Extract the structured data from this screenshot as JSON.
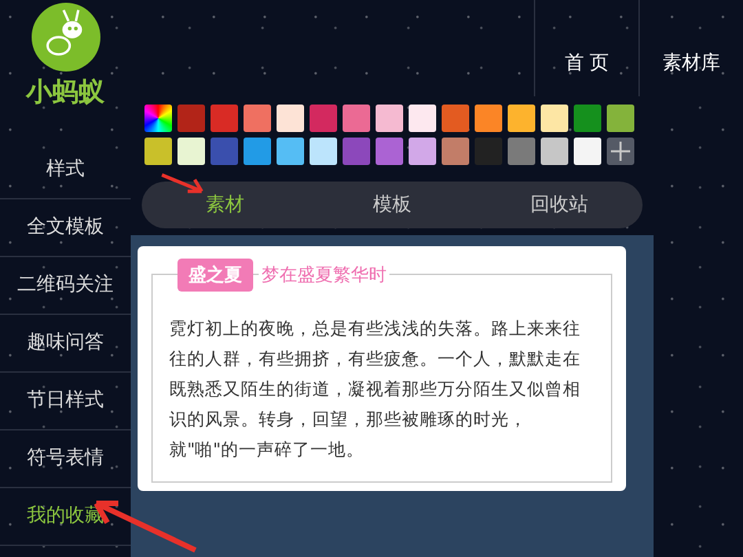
{
  "logo": {
    "text": "小蚂蚁"
  },
  "top_nav": [
    {
      "label": "首 页"
    },
    {
      "label": "素材库"
    }
  ],
  "sidebar": {
    "items": [
      {
        "label": "样式",
        "selected": false
      },
      {
        "label": "全文模板",
        "selected": false
      },
      {
        "label": "二维码关注",
        "selected": false
      },
      {
        "label": "趣味问答",
        "selected": false
      },
      {
        "label": "节日样式",
        "selected": false
      },
      {
        "label": "符号表情",
        "selected": false
      },
      {
        "label": "我的收藏",
        "selected": true
      }
    ]
  },
  "palette": [
    {
      "kind": "rainbow"
    },
    {
      "kind": "color",
      "color": "#b22418"
    },
    {
      "kind": "color",
      "color": "#d92b25"
    },
    {
      "kind": "color",
      "color": "#ef7061"
    },
    {
      "kind": "color",
      "color": "#fde3d6"
    },
    {
      "kind": "color",
      "color": "#d3295f"
    },
    {
      "kind": "color",
      "color": "#eb6a94"
    },
    {
      "kind": "color",
      "color": "#f5bad1"
    },
    {
      "kind": "color",
      "color": "#fde8ef"
    },
    {
      "kind": "color",
      "color": "#e35b21"
    },
    {
      "kind": "color",
      "color": "#fb8526"
    },
    {
      "kind": "color",
      "color": "#fdb32d"
    },
    {
      "kind": "color",
      "color": "#fde6a4"
    },
    {
      "kind": "color",
      "color": "#15901d"
    },
    {
      "kind": "color",
      "color": "#84b33b"
    },
    {
      "kind": "color",
      "color": "#c9c02a"
    },
    {
      "kind": "color",
      "color": "#e8f4d2"
    },
    {
      "kind": "color",
      "color": "#3a4fad"
    },
    {
      "kind": "color",
      "color": "#229be6"
    },
    {
      "kind": "color",
      "color": "#55bdf4"
    },
    {
      "kind": "color",
      "color": "#bce4fc"
    },
    {
      "kind": "color",
      "color": "#8c48bb"
    },
    {
      "kind": "color",
      "color": "#ab63d3"
    },
    {
      "kind": "color",
      "color": "#d2a8e8"
    },
    {
      "kind": "color",
      "color": "#c27d68"
    },
    {
      "kind": "color",
      "color": "#222222"
    },
    {
      "kind": "color",
      "color": "#7a7a7a"
    },
    {
      "kind": "color",
      "color": "#c6c6c6"
    },
    {
      "kind": "color",
      "color": "#f4f4f4"
    },
    {
      "kind": "add"
    }
  ],
  "tabs": [
    {
      "label": "素材",
      "selected": true
    },
    {
      "label": "模板",
      "selected": false
    },
    {
      "label": "回收站",
      "selected": false
    }
  ],
  "card": {
    "badge": "盛之夏",
    "subtitle": "梦在盛夏繁华时",
    "body": "霓灯初上的夜晚，总是有些浅浅的失落。路上来来往往的人群，有些拥挤，有些疲惫。一个人，默默走在既熟悉又陌生的街道，凝视着那些万分陌生又似曾相识的风景。转身，回望，那些被雕琢的时光，就\"啪\"的一声碎了一地。"
  }
}
